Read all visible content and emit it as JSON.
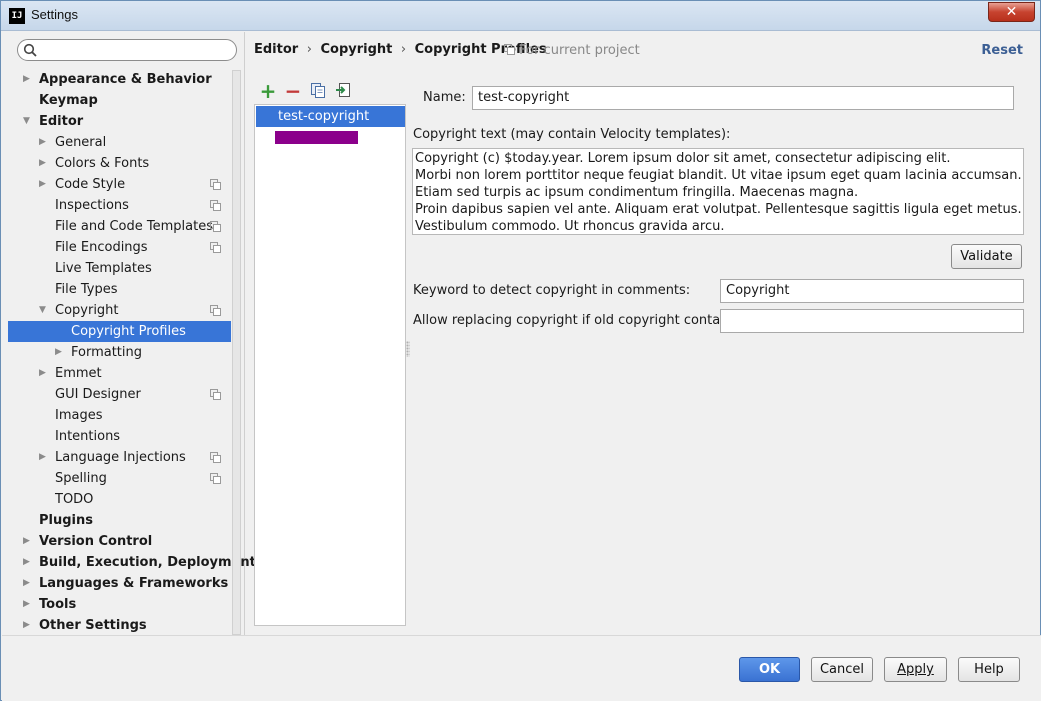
{
  "window": {
    "title": "Settings",
    "app_icon": "IJ",
    "close_glyph": "✕"
  },
  "search": {
    "value": "",
    "placeholder": ""
  },
  "tree": [
    {
      "label": "Appearance & Behavior",
      "bold": true,
      "arrow": "right",
      "level": 0,
      "project_icon": false
    },
    {
      "label": "Keymap",
      "bold": true,
      "arrow": "none",
      "level": 0,
      "project_icon": false
    },
    {
      "label": "Editor",
      "bold": true,
      "arrow": "down",
      "level": 0,
      "project_icon": false
    },
    {
      "label": "General",
      "bold": false,
      "arrow": "right",
      "level": 1,
      "project_icon": false
    },
    {
      "label": "Colors & Fonts",
      "bold": false,
      "arrow": "right",
      "level": 1,
      "project_icon": false
    },
    {
      "label": "Code Style",
      "bold": false,
      "arrow": "right",
      "level": 1,
      "project_icon": true
    },
    {
      "label": "Inspections",
      "bold": false,
      "arrow": "none",
      "level": 1,
      "project_icon": true
    },
    {
      "label": "File and Code Templates",
      "bold": false,
      "arrow": "none",
      "level": 1,
      "project_icon": true
    },
    {
      "label": "File Encodings",
      "bold": false,
      "arrow": "none",
      "level": 1,
      "project_icon": true
    },
    {
      "label": "Live Templates",
      "bold": false,
      "arrow": "none",
      "level": 1,
      "project_icon": false
    },
    {
      "label": "File Types",
      "bold": false,
      "arrow": "none",
      "level": 1,
      "project_icon": false
    },
    {
      "label": "Copyright",
      "bold": false,
      "arrow": "down",
      "level": 1,
      "project_icon": true
    },
    {
      "label": "Copyright Profiles",
      "bold": false,
      "arrow": "none",
      "level": 2,
      "project_icon": false,
      "selected": true
    },
    {
      "label": "Formatting",
      "bold": false,
      "arrow": "right",
      "level": 2,
      "project_icon": false
    },
    {
      "label": "Emmet",
      "bold": false,
      "arrow": "right",
      "level": 1,
      "project_icon": false
    },
    {
      "label": "GUI Designer",
      "bold": false,
      "arrow": "none",
      "level": 1,
      "project_icon": true
    },
    {
      "label": "Images",
      "bold": false,
      "arrow": "none",
      "level": 1,
      "project_icon": false
    },
    {
      "label": "Intentions",
      "bold": false,
      "arrow": "none",
      "level": 1,
      "project_icon": false
    },
    {
      "label": "Language Injections",
      "bold": false,
      "arrow": "right",
      "level": 1,
      "project_icon": true
    },
    {
      "label": "Spelling",
      "bold": false,
      "arrow": "none",
      "level": 1,
      "project_icon": true
    },
    {
      "label": "TODO",
      "bold": false,
      "arrow": "none",
      "level": 1,
      "project_icon": false
    },
    {
      "label": "Plugins",
      "bold": true,
      "arrow": "none",
      "level": 0,
      "project_icon": false
    },
    {
      "label": "Version Control",
      "bold": true,
      "arrow": "right",
      "level": 0,
      "project_icon": false
    },
    {
      "label": "Build, Execution, Deployment",
      "bold": true,
      "arrow": "right",
      "level": 0,
      "project_icon": false
    },
    {
      "label": "Languages & Frameworks",
      "bold": true,
      "arrow": "right",
      "level": 0,
      "project_icon": false
    },
    {
      "label": "Tools",
      "bold": true,
      "arrow": "right",
      "level": 0,
      "project_icon": false
    },
    {
      "label": "Other Settings",
      "bold": true,
      "arrow": "right",
      "level": 0,
      "project_icon": false
    }
  ],
  "header": {
    "breadcrumb": [
      "Editor",
      "Copyright",
      "Copyright Profiles"
    ],
    "breadcrumb_sep": "›",
    "scope_note": "For current project",
    "reset_label": "Reset"
  },
  "profiles": {
    "toolbar": [
      {
        "icon": "add-icon",
        "glyph": "+",
        "color": "#3a9a3a"
      },
      {
        "icon": "remove-icon",
        "glyph": "−",
        "color": "#c23a3a"
      },
      {
        "icon": "copy-icon",
        "glyph": "",
        "color": "#4a6fa5"
      },
      {
        "icon": "import-icon",
        "glyph": "",
        "color": "#2e8a4a"
      }
    ],
    "items": [
      "test-copyright"
    ],
    "redacted_color": "#8b008b"
  },
  "form": {
    "name_label": "Name:",
    "name_value": "test-copyright",
    "copyright_text_label": "Copyright text (may contain Velocity templates):",
    "copyright_text_lines": [
      "Copyright (c) $today.year. Lorem ipsum dolor sit amet, consectetur adipiscing elit.",
      "Morbi non lorem porttitor neque feugiat blandit. Ut vitae ipsum eget quam lacinia accumsan.",
      "Etiam sed turpis ac ipsum condimentum fringilla. Maecenas magna.",
      "Proin dapibus sapien vel ante. Aliquam erat volutpat. Pellentesque sagittis ligula eget metus.",
      "Vestibulum commodo. Ut rhoncus gravida arcu."
    ],
    "validate_label": "Validate",
    "keyword_label": "Keyword to detect copyright in comments:",
    "keyword_value": "Copyright",
    "allow_replace_label": "Allow replacing copyright if old copyright contains:",
    "allow_replace_value": ""
  },
  "footer": {
    "ok_label": "OK",
    "cancel_label": "Cancel",
    "apply_label": "Apply",
    "help_label": "Help"
  },
  "colors": {
    "selection": "#3875d7",
    "accent_link": "#3c5f94"
  }
}
